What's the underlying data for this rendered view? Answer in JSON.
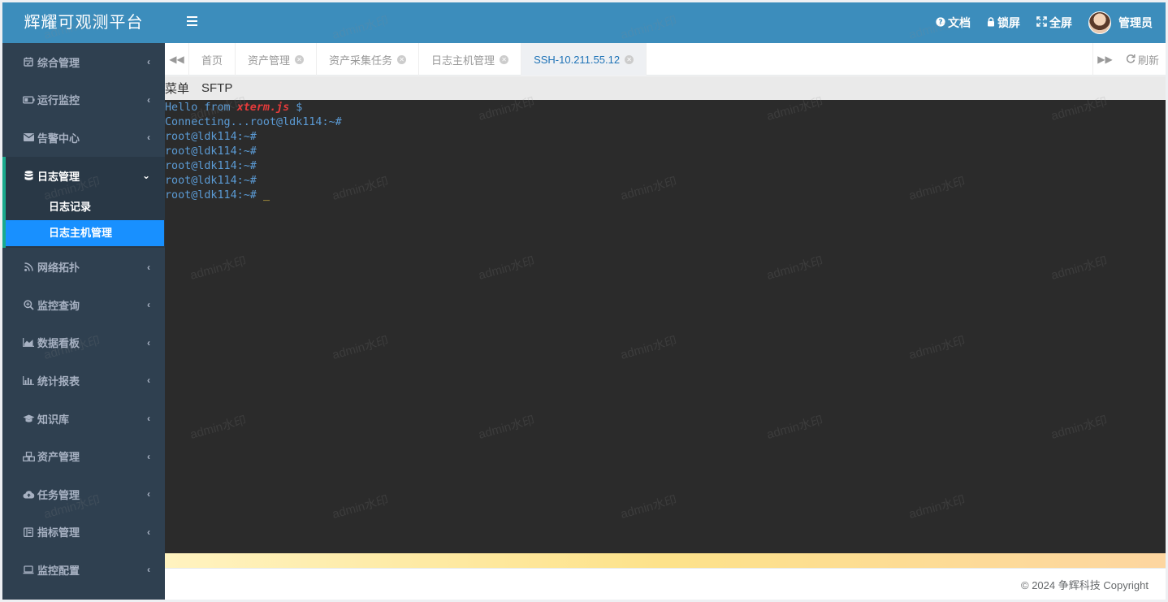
{
  "brand": {
    "title": "辉耀可观测平台"
  },
  "header": {
    "docs": "文档",
    "lock": "锁屏",
    "fullscreen": "全屏",
    "user": "管理员"
  },
  "sidebar": {
    "items": [
      {
        "label": "综合管理",
        "icon": "calendar-check-icon"
      },
      {
        "label": "运行监控",
        "icon": "battery-icon"
      },
      {
        "label": "告警中心",
        "icon": "envelope-icon"
      },
      {
        "label": "日志管理",
        "icon": "database-icon",
        "expanded": true,
        "children": [
          {
            "label": "日志记录"
          },
          {
            "label": "日志主机管理",
            "selected": true
          }
        ]
      },
      {
        "label": "网络拓扑",
        "icon": "rss-icon"
      },
      {
        "label": "监控查询",
        "icon": "search-plus-icon"
      },
      {
        "label": "数据看板",
        "icon": "area-chart-icon"
      },
      {
        "label": "统计报表",
        "icon": "bar-chart-icon"
      },
      {
        "label": "知识库",
        "icon": "graduation-cap-icon"
      },
      {
        "label": "资产管理",
        "icon": "cubes-icon"
      },
      {
        "label": "任务管理",
        "icon": "cloud-upload-icon"
      },
      {
        "label": "指标管理",
        "icon": "archive-icon"
      },
      {
        "label": "监控配置",
        "icon": "laptop-icon"
      }
    ]
  },
  "tabs": [
    {
      "label": "首页",
      "closable": false
    },
    {
      "label": "资产管理",
      "closable": true
    },
    {
      "label": "资产采集任务",
      "closable": true
    },
    {
      "label": "日志主机管理",
      "closable": true
    },
    {
      "label": "SSH-10.211.55.12",
      "closable": true,
      "active": true
    }
  ],
  "refresh_label": "刷新",
  "toolbar": {
    "menu": "菜单",
    "sftp": "SFTP"
  },
  "terminal": {
    "hello_prefix": "Hello from ",
    "hello_xterm": "xterm.js",
    "hello_suffix": " $",
    "lines": [
      "Connecting...root@ldk114:~#",
      "root@ldk114:~#",
      "root@ldk114:~#",
      "root@ldk114:~#",
      "root@ldk114:~#"
    ],
    "last_prompt": "root@ldk114:~# ",
    "cursor": "_"
  },
  "footer": {
    "copyright": "© 2024 争辉科技 Copyright"
  },
  "watermark": "admin水印",
  "colors": {
    "header": "#3c8dbc",
    "sidebar": "#2f4050",
    "accent": "#1890ff",
    "terminal_bg": "#2b2b2b"
  }
}
